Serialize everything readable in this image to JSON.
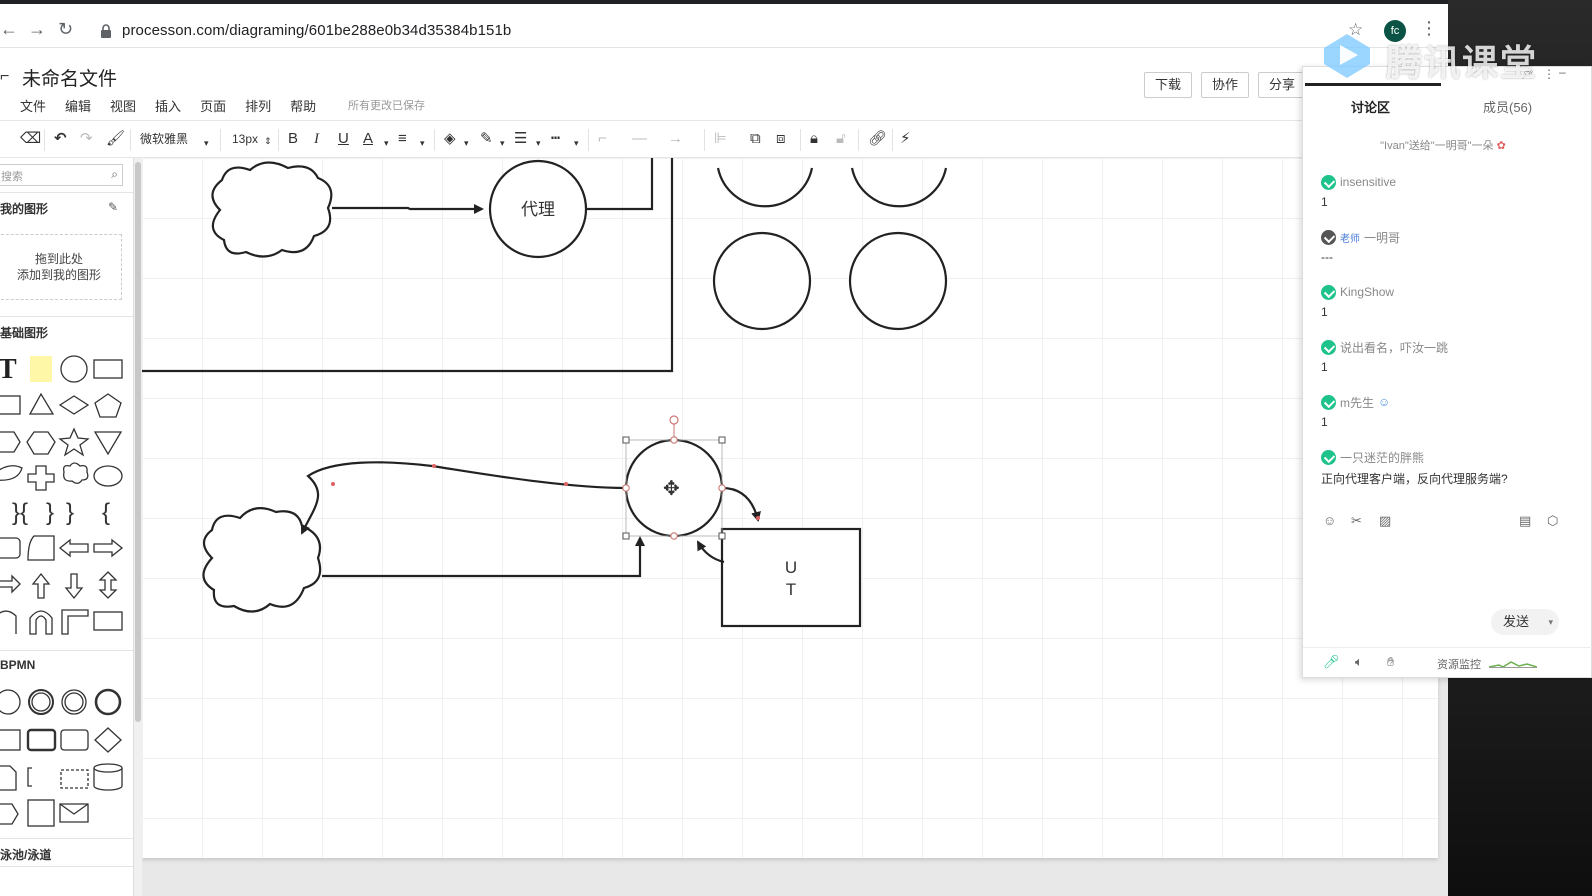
{
  "browser": {
    "url": "processon.com/diagraming/601be288e0b34d35384b151b",
    "profile_initials": "fc"
  },
  "app": {
    "doc_title": "未命名文件",
    "menu": [
      "文件",
      "编辑",
      "视图",
      "插入",
      "页面",
      "排列",
      "帮助"
    ],
    "save_status": "所有更改已保存",
    "header_buttons": {
      "download": "下载",
      "collaborate": "协作",
      "share": "分享"
    }
  },
  "toolbar": {
    "font_family": "微软雅黑",
    "font_size": "13px",
    "bold": "B",
    "italic": "I",
    "underline": "U",
    "font_color": "A"
  },
  "left_panel": {
    "search_placeholder": "搜索",
    "my_shapes_title": "我的图形",
    "drop_hint_line1": "拖到此处",
    "drop_hint_line2": "添加到我的图形",
    "basic_shapes_title": "基础图形",
    "bpmn_title": "BPMN",
    "swimlane_title": "泳池/泳道"
  },
  "diagram": {
    "proxy_label": "代理",
    "box_label_line1": "U",
    "box_label_line2": "T"
  },
  "chat": {
    "tab_discuss": "讨论区",
    "tab_members": "成员(56)",
    "gift_message": "\"Ivan\"送给\"一明哥\"一朵",
    "messages": [
      {
        "name": "insensitive",
        "text": "1"
      },
      {
        "name": "一明哥",
        "tag": "老师",
        "text": "---"
      },
      {
        "name": "KingShow",
        "text": "1"
      },
      {
        "name": "说出看名，吓汝一跳",
        "text": "1"
      },
      {
        "name": "m先生",
        "text": "1"
      },
      {
        "name": "一只迷茫的胖熊",
        "text": "正向代理客户端，反向代理服务端?"
      }
    ],
    "send_label": "发送",
    "resource_monitor": "资源监控"
  },
  "watermark": {
    "text": "腾讯课堂"
  }
}
